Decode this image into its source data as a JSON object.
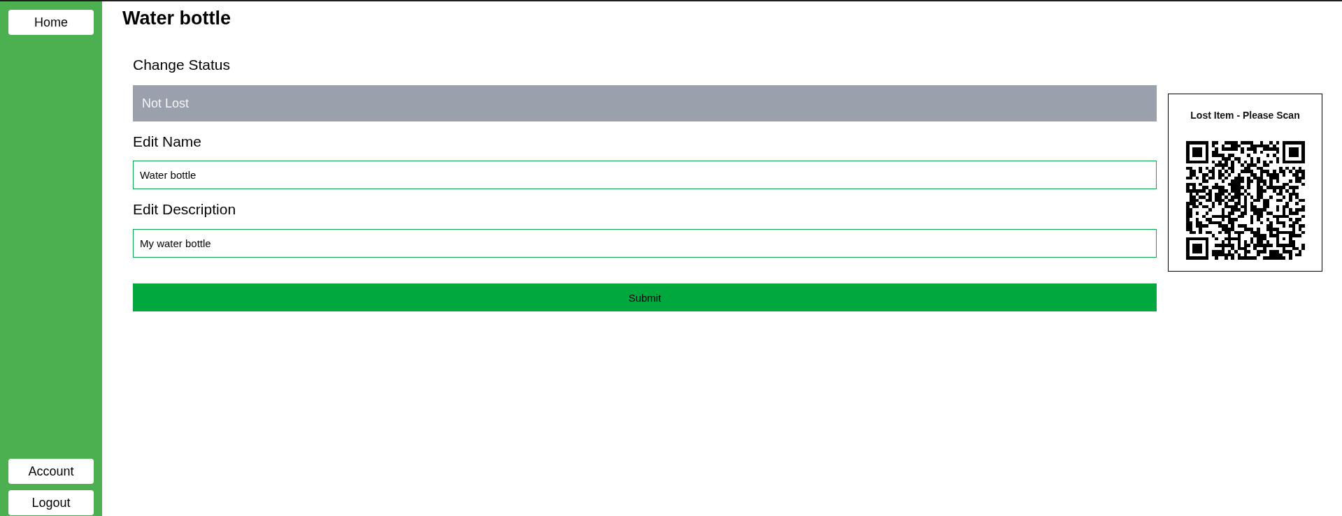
{
  "sidebar": {
    "top_items": [
      {
        "label": "Home"
      }
    ],
    "bottom_items": [
      {
        "label": "Account"
      },
      {
        "label": "Logout"
      }
    ]
  },
  "page_title": "Water bottle",
  "form": {
    "status": {
      "label": "Change Status",
      "value": "Not Lost"
    },
    "name": {
      "label": "Edit Name",
      "value": "Water bottle"
    },
    "description": {
      "label": "Edit Description",
      "value": "My water bottle"
    },
    "submit": "Submit"
  },
  "qr_card": {
    "caption": "Lost Item - Please Scan"
  }
}
